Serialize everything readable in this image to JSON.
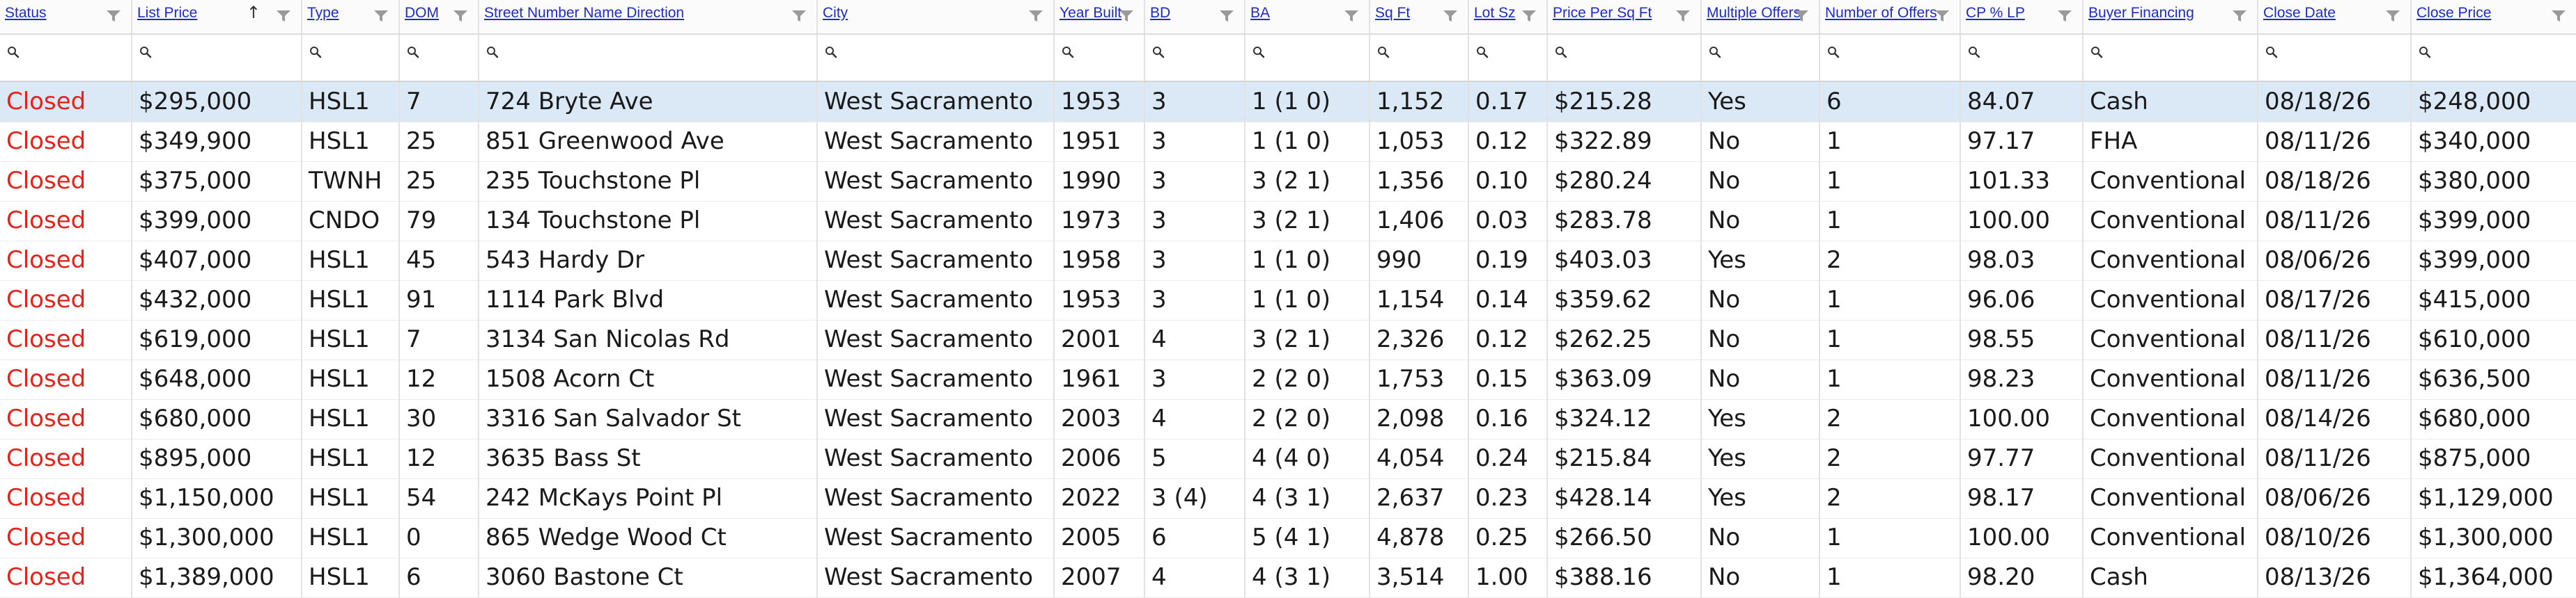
{
  "columns": [
    {
      "key": "status",
      "label": "Status"
    },
    {
      "key": "list_price",
      "label": "List Price"
    },
    {
      "key": "type",
      "label": "Type"
    },
    {
      "key": "dom",
      "label": "DOM"
    },
    {
      "key": "street",
      "label": "Street Number Name Direction"
    },
    {
      "key": "city",
      "label": "City"
    },
    {
      "key": "year_built",
      "label": "Year Built"
    },
    {
      "key": "bd",
      "label": "BD"
    },
    {
      "key": "ba",
      "label": "BA"
    },
    {
      "key": "sqft",
      "label": "Sq Ft"
    },
    {
      "key": "lot_sz",
      "label": "Lot Sz"
    },
    {
      "key": "ppsf",
      "label": "Price Per Sq Ft"
    },
    {
      "key": "multiple_offers",
      "label": "Multiple Offers"
    },
    {
      "key": "num_offers",
      "label": "Number of Offers"
    },
    {
      "key": "cp_lp",
      "label": "CP % LP"
    },
    {
      "key": "buyer_financing",
      "label": "Buyer Financing"
    },
    {
      "key": "close_date",
      "label": "Close Date"
    },
    {
      "key": "close_price",
      "label": "Close Price"
    }
  ],
  "sort": {
    "column": "list_price",
    "direction": "ascending",
    "icon": "sort-ascending-icon"
  },
  "filter_icon": "funnel-icon",
  "search_icon": "magnifier-icon",
  "selected_row": 0,
  "colors": {
    "status_closed": "#e5221c",
    "header_link": "#1f2bc8",
    "selected_row_bg": "#dbe9f6"
  },
  "rows": [
    [
      "Closed",
      "$295,000",
      "HSL1",
      "7",
      "724 Bryte Ave",
      "West Sacramento",
      "1953",
      "3",
      "1 (1 0)",
      "1,152",
      "0.17",
      "$215.28",
      "Yes",
      "6",
      "84.07",
      "Cash",
      "08/18/26",
      "$248,000"
    ],
    [
      "Closed",
      "$349,900",
      "HSL1",
      "25",
      "851 Greenwood Ave",
      "West Sacramento",
      "1951",
      "3",
      "1 (1 0)",
      "1,053",
      "0.12",
      "$322.89",
      "No",
      "1",
      "97.17",
      "FHA",
      "08/11/26",
      "$340,000"
    ],
    [
      "Closed",
      "$375,000",
      "TWNH",
      "25",
      "235 Touchstone Pl",
      "West Sacramento",
      "1990",
      "3",
      "3 (2 1)",
      "1,356",
      "0.10",
      "$280.24",
      "No",
      "1",
      "101.33",
      "Conventional",
      "08/18/26",
      "$380,000"
    ],
    [
      "Closed",
      "$399,000",
      "CNDO",
      "79",
      "134 Touchstone Pl",
      "West Sacramento",
      "1973",
      "3",
      "3 (2 1)",
      "1,406",
      "0.03",
      "$283.78",
      "No",
      "1",
      "100.00",
      "Conventional",
      "08/11/26",
      "$399,000"
    ],
    [
      "Closed",
      "$407,000",
      "HSL1",
      "45",
      "543 Hardy Dr",
      "West Sacramento",
      "1958",
      "3",
      "1 (1 0)",
      "990",
      "0.19",
      "$403.03",
      "Yes",
      "2",
      "98.03",
      "Conventional",
      "08/06/26",
      "$399,000"
    ],
    [
      "Closed",
      "$432,000",
      "HSL1",
      "91",
      "1114 Park Blvd",
      "West Sacramento",
      "1953",
      "3",
      "1 (1 0)",
      "1,154",
      "0.14",
      "$359.62",
      "No",
      "1",
      "96.06",
      "Conventional",
      "08/17/26",
      "$415,000"
    ],
    [
      "Closed",
      "$619,000",
      "HSL1",
      "7",
      "3134 San Nicolas Rd",
      "West Sacramento",
      "2001",
      "4",
      "3 (2 1)",
      "2,326",
      "0.12",
      "$262.25",
      "No",
      "1",
      "98.55",
      "Conventional",
      "08/11/26",
      "$610,000"
    ],
    [
      "Closed",
      "$648,000",
      "HSL1",
      "12",
      "1508 Acorn Ct",
      "West Sacramento",
      "1961",
      "3",
      "2 (2 0)",
      "1,753",
      "0.15",
      "$363.09",
      "No",
      "1",
      "98.23",
      "Conventional",
      "08/11/26",
      "$636,500"
    ],
    [
      "Closed",
      "$680,000",
      "HSL1",
      "30",
      "3316 San Salvador St",
      "West Sacramento",
      "2003",
      "4",
      "2 (2 0)",
      "2,098",
      "0.16",
      "$324.12",
      "Yes",
      "2",
      "100.00",
      "Conventional",
      "08/14/26",
      "$680,000"
    ],
    [
      "Closed",
      "$895,000",
      "HSL1",
      "12",
      "3635 Bass St",
      "West Sacramento",
      "2006",
      "5",
      "4 (4 0)",
      "4,054",
      "0.24",
      "$215.84",
      "Yes",
      "2",
      "97.77",
      "Conventional",
      "08/11/26",
      "$875,000"
    ],
    [
      "Closed",
      "$1,150,000",
      "HSL1",
      "54",
      "242 McKays Point Pl",
      "West Sacramento",
      "2022",
      "3 (4)",
      "4 (3 1)",
      "2,637",
      "0.23",
      "$428.14",
      "Yes",
      "2",
      "98.17",
      "Conventional",
      "08/06/26",
      "$1,129,000"
    ],
    [
      "Closed",
      "$1,300,000",
      "HSL1",
      "0",
      "865 Wedge Wood Ct",
      "West Sacramento",
      "2005",
      "6",
      "5 (4 1)",
      "4,878",
      "0.25",
      "$266.50",
      "No",
      "1",
      "100.00",
      "Conventional",
      "08/10/26",
      "$1,300,000"
    ],
    [
      "Closed",
      "$1,389,000",
      "HSL1",
      "6",
      "3060 Bastone Ct",
      "West Sacramento",
      "2007",
      "4",
      "4 (3 1)",
      "3,514",
      "1.00",
      "$388.16",
      "No",
      "1",
      "98.20",
      "Cash",
      "08/13/26",
      "$1,364,000"
    ]
  ]
}
